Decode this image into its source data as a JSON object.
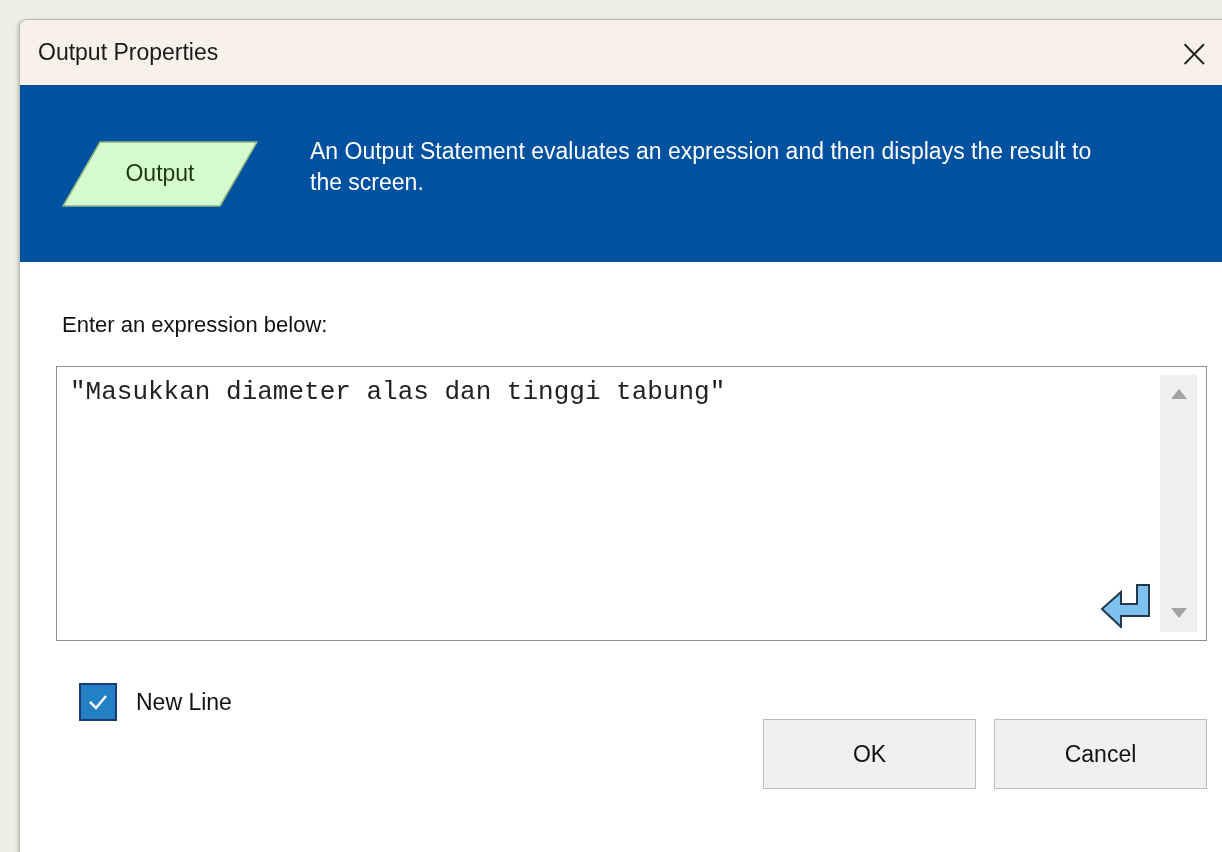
{
  "window": {
    "title": "Output Properties",
    "close": "×"
  },
  "banner": {
    "shape_label": "Output",
    "description": "An Output Statement evaluates an expression and then displays the result to the screen."
  },
  "expression": {
    "label": "Enter an expression below:",
    "value": "\"Masukkan diameter alas dan tinggi tabung\""
  },
  "new_line": {
    "label": "New Line",
    "checked": true
  },
  "buttons": [
    {
      "label": "OK"
    },
    {
      "label": "Cancel"
    }
  ]
}
